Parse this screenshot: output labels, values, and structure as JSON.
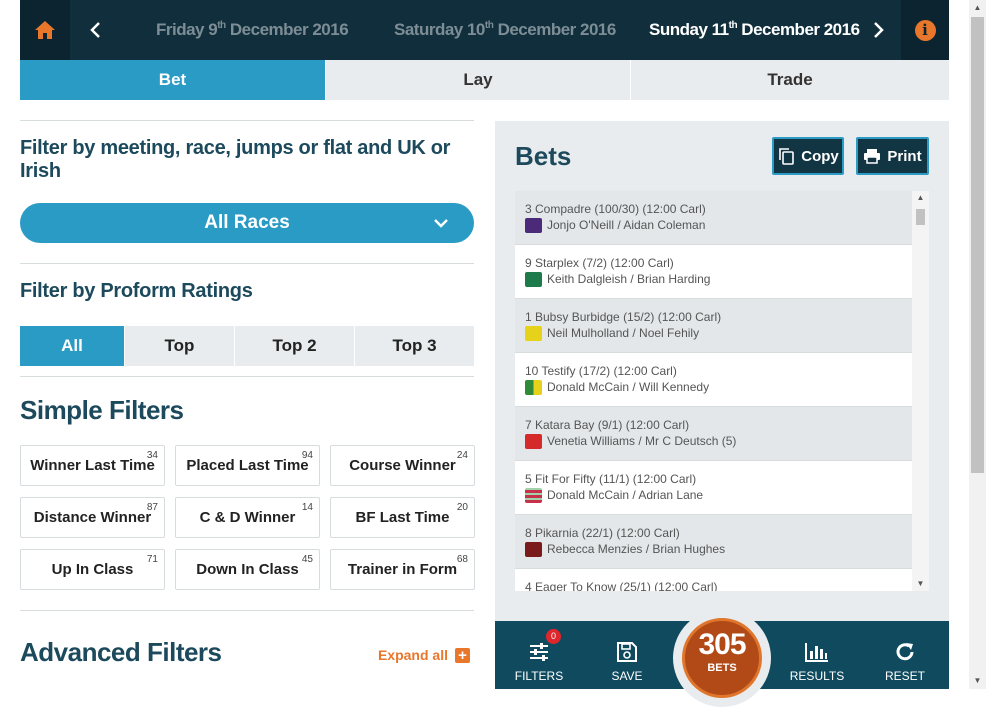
{
  "datebar": {
    "days": [
      {
        "prefix": "Friday 9",
        "suffix": "th",
        "rest": "December 2016"
      },
      {
        "prefix": "Saturday 10",
        "suffix": "th",
        "rest": "December 2016"
      },
      {
        "prefix": "Sunday 11",
        "suffix": "th",
        "rest": "December 2016"
      }
    ],
    "active_index": 2,
    "info_glyph": "i",
    "icons": {
      "home": "home-icon",
      "prev": "chevron-left-icon",
      "next": "chevron-right-icon",
      "info": "info-icon"
    }
  },
  "mode_tabs": [
    {
      "label": "Bet",
      "active": true
    },
    {
      "label": "Lay",
      "active": false
    },
    {
      "label": "Trade",
      "active": false
    }
  ],
  "filters": {
    "meeting_title": "Filter by meeting, race, jumps or flat and UK or Irish",
    "race_select": "All Races",
    "proform_title": "Filter by Proform Ratings",
    "rating_tabs": [
      {
        "label": "All",
        "active": true
      },
      {
        "label": "Top",
        "active": false
      },
      {
        "label": "Top 2",
        "active": false
      },
      {
        "label": "Top 3",
        "active": false
      }
    ],
    "simple_title": "Simple Filters",
    "simple": [
      {
        "label": "Winner Last Time",
        "count": "34"
      },
      {
        "label": "Placed Last Time",
        "count": "94"
      },
      {
        "label": "Course Winner",
        "count": "24"
      },
      {
        "label": "Distance Winner",
        "count": "87"
      },
      {
        "label": "C & D Winner",
        "count": "14"
      },
      {
        "label": "BF Last Time",
        "count": "20"
      },
      {
        "label": "Up In Class",
        "count": "71"
      },
      {
        "label": "Down In Class",
        "count": "45"
      },
      {
        "label": "Trainer in Form",
        "count": "68"
      }
    ],
    "advanced_title": "Advanced Filters",
    "expand_label": "Expand all"
  },
  "bets": {
    "title": "Bets",
    "copy_label": "Copy",
    "print_label": "Print",
    "rows": [
      {
        "line1": "3 Compadre (100/30) (12:00 Carl)",
        "line2": "Jonjo O'Neill / Aidan Coleman",
        "silk": "#4b2a7a"
      },
      {
        "line1": "9 Starplex (7/2) (12:00 Carl)",
        "line2": "Keith Dalgleish / Brian Harding",
        "silk": "#1d7a4a"
      },
      {
        "line1": "1 Bubsy Burbidge (15/2) (12:00 Carl)",
        "line2": "Neil Mulholland / Noel Fehily",
        "silk": "#e6d21a"
      },
      {
        "line1": "10 Testify (17/2) (12:00 Carl)",
        "line2": "Donald McCain / Will Kennedy",
        "silk": "#2f8a3a"
      },
      {
        "line1": "7 Katara Bay (9/1) (12:00 Carl)",
        "line2": "Venetia Williams / Mr C Deutsch (5)",
        "silk": "#d42a2a"
      },
      {
        "line1": "5 Fit For Fifty (11/1) (12:00 Carl)",
        "line2": "Donald McCain / Adrian Lane",
        "silk": "#c7314a"
      },
      {
        "line1": "8 Pikarnia (22/1) (12:00 Carl)",
        "line2": "Rebecca Menzies / Brian Hughes",
        "silk": "#7a1a1a"
      },
      {
        "line1": "4 Eager To Know (25/1) (12:00 Carl)",
        "line2": "",
        "silk": ""
      }
    ]
  },
  "actionbar": {
    "filters_label": "FILTERS",
    "filters_badge": "0",
    "save_label": "SAVE",
    "bets_count": "305",
    "bets_label": "BETS",
    "results_label": "RESULTS",
    "reset_label": "RESET"
  },
  "colors": {
    "accent": "#2a9bc4",
    "dark": "#102e3c",
    "orange": "#e8772b",
    "title": "#1c4a5c"
  }
}
